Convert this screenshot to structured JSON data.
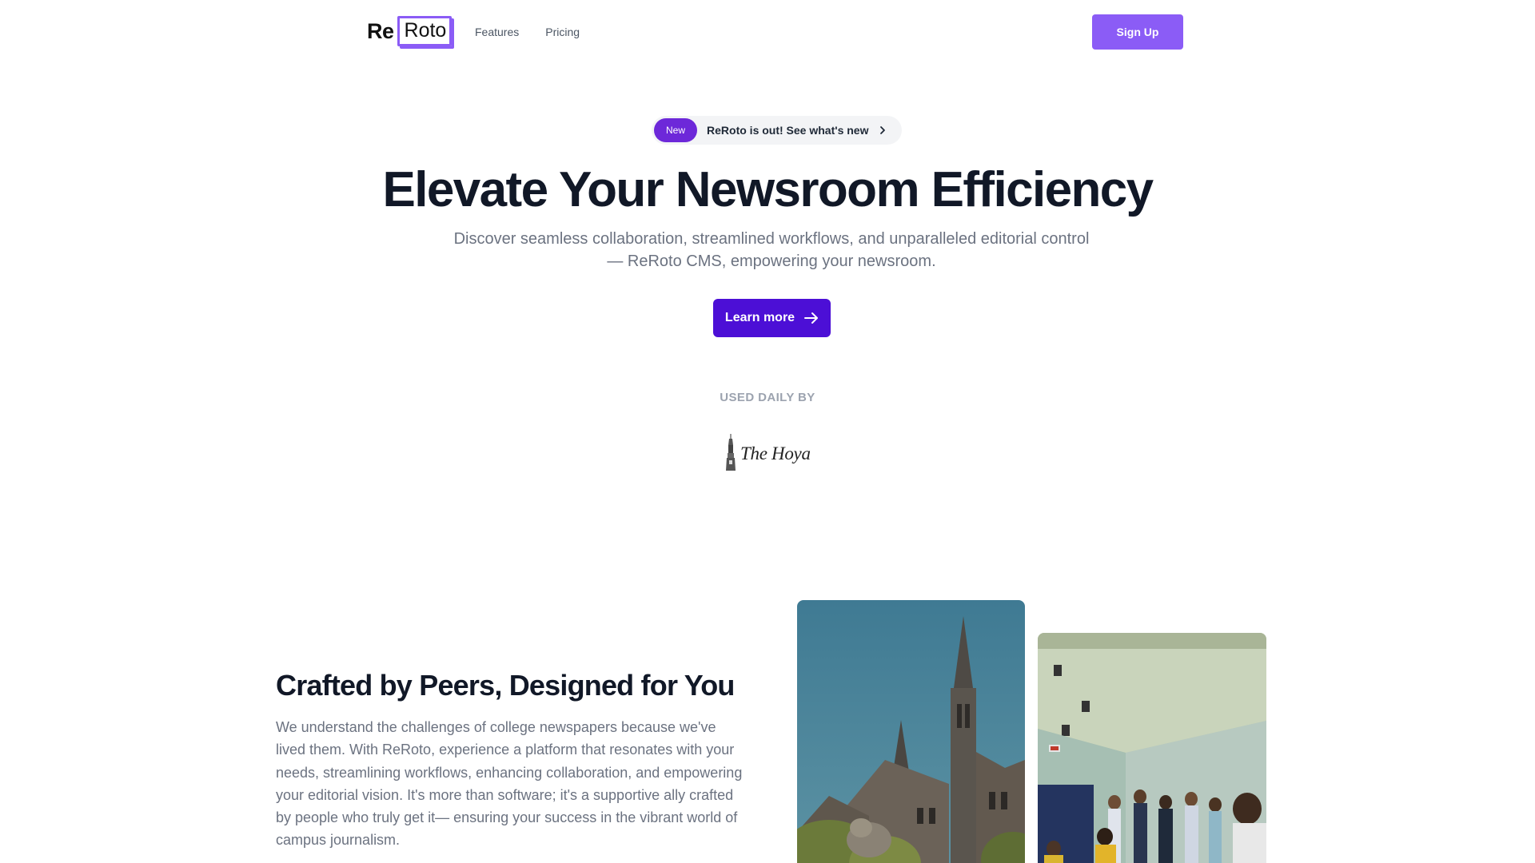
{
  "nav": {
    "logo_part1": "Re",
    "logo_part2": "Roto",
    "links": [
      "Features",
      "Pricing"
    ],
    "signup_label": "Sign Up"
  },
  "announcement": {
    "badge": "New",
    "text": "ReRoto is out! See what's new"
  },
  "hero": {
    "title": "Elevate Your Newsroom Efficiency",
    "subtitle": "Discover seamless collaboration, streamlined workflows, and unparalleled editorial control — ReRoto CMS, empowering your newsroom.",
    "cta_label": "Learn more",
    "used_by_label": "USED DAILY BY",
    "customer_logo_text": "The Hoya"
  },
  "section": {
    "title": "Crafted by Peers, Designed for You",
    "body": "We understand the challenges of college newspapers because we've lived them. With ReRoto, experience a platform that resonates with your needs, streamlining workflows, enhancing collaboration, and empowering your editorial vision. It's more than software; it's a supportive ally crafted by people who truly get it— ensuring your success in the vibrant world of campus journalism."
  },
  "colors": {
    "brand_purple": "#8b5cf6",
    "primary_cta": "#4c0fd6",
    "badge": "#6d28d9"
  },
  "icons": [
    "chevron-right-icon",
    "arrow-right-icon",
    "tower-icon"
  ],
  "images": [
    "campus-building-photo",
    "newsroom-group-photo"
  ]
}
